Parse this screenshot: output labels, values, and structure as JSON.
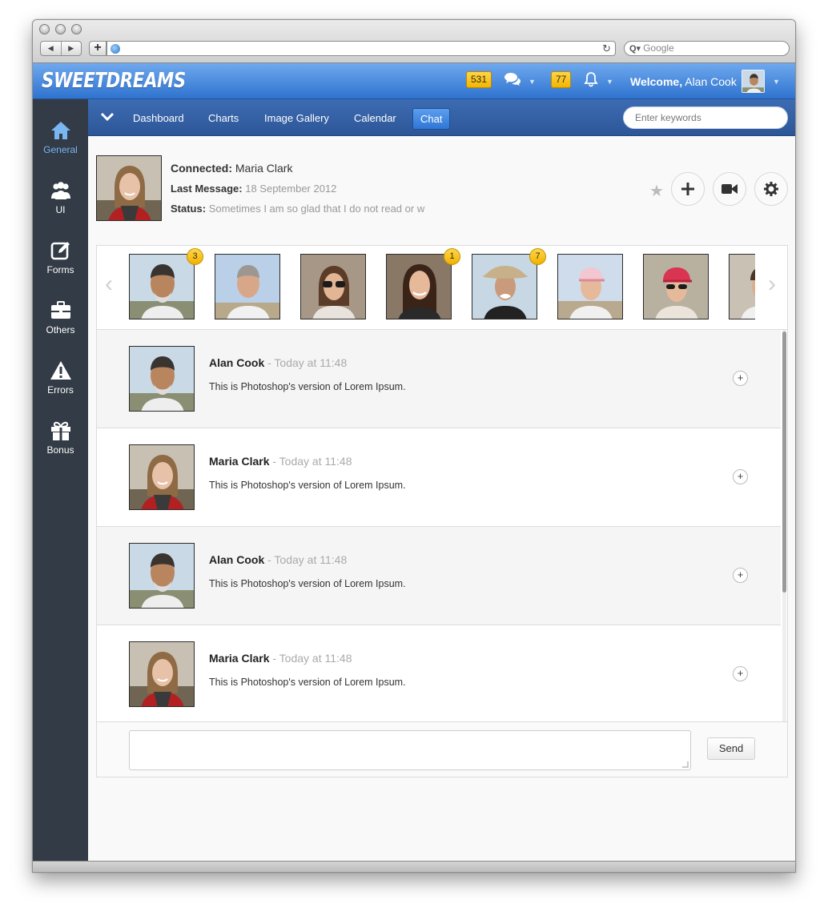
{
  "browser": {
    "search_placeholder": "Google",
    "url": ""
  },
  "app": {
    "logo": "SWEETDREAMS",
    "messages_count": "531",
    "notifications_count": "77",
    "welcome_label": "Welcome,",
    "user_name": "Alan Cook"
  },
  "sidebar": {
    "items": [
      {
        "label": "General",
        "icon": "home-icon",
        "active": true
      },
      {
        "label": "UI",
        "icon": "users-icon"
      },
      {
        "label": "Forms",
        "icon": "edit-icon"
      },
      {
        "label": "Others",
        "icon": "briefcase-icon"
      },
      {
        "label": "Errors",
        "icon": "warning-icon"
      },
      {
        "label": "Bonus",
        "icon": "gift-icon"
      }
    ]
  },
  "subnav": {
    "links": [
      "Dashboard",
      "Charts",
      "Image Gallery",
      "Calendar",
      "Chat"
    ],
    "active": "Chat",
    "search_placeholder": "Enter keywords"
  },
  "profile": {
    "connected_label": "Connected:",
    "connected_name": "Maria Clark",
    "last_message_label": "Last Message:",
    "last_message_value": "18 September 2012",
    "status_label": "Status:",
    "status_value": "Sometimes I am so glad that I do not read or w"
  },
  "contacts": [
    {
      "badge": "3",
      "photo": "man-grey-beard"
    },
    {
      "badge": "",
      "photo": "man-grey-hair"
    },
    {
      "badge": "",
      "photo": "woman-sunglasses"
    },
    {
      "badge": "1",
      "photo": "woman-dark-hair"
    },
    {
      "badge": "7",
      "photo": "man-hat"
    },
    {
      "badge": "",
      "photo": "woman-pink-cap"
    },
    {
      "badge": "",
      "photo": "woman-red-cap"
    },
    {
      "badge": "",
      "photo": "partial-contact"
    }
  ],
  "messages": [
    {
      "author": "Alan Cook",
      "time": "- Today at 11:48",
      "text": "This is Photoshop's version of Lorem Ipsum."
    },
    {
      "author": "Maria Clark",
      "time": "- Today at 11:48",
      "text": "This is Photoshop's version of Lorem Ipsum."
    },
    {
      "author": "Alan Cook",
      "time": "- Today at 11:48",
      "text": "This is Photoshop's version of Lorem Ipsum."
    },
    {
      "author": "Maria Clark",
      "time": "- Today at 11:48",
      "text": "This is Photoshop's version of Lorem Ipsum."
    }
  ],
  "compose": {
    "send_label": "Send"
  },
  "colors": {
    "header_blue": "#2f73cf",
    "sidebar_dark": "#323b46",
    "badge_yellow": "#f2b600",
    "active_nav": "#7ab6f0"
  }
}
